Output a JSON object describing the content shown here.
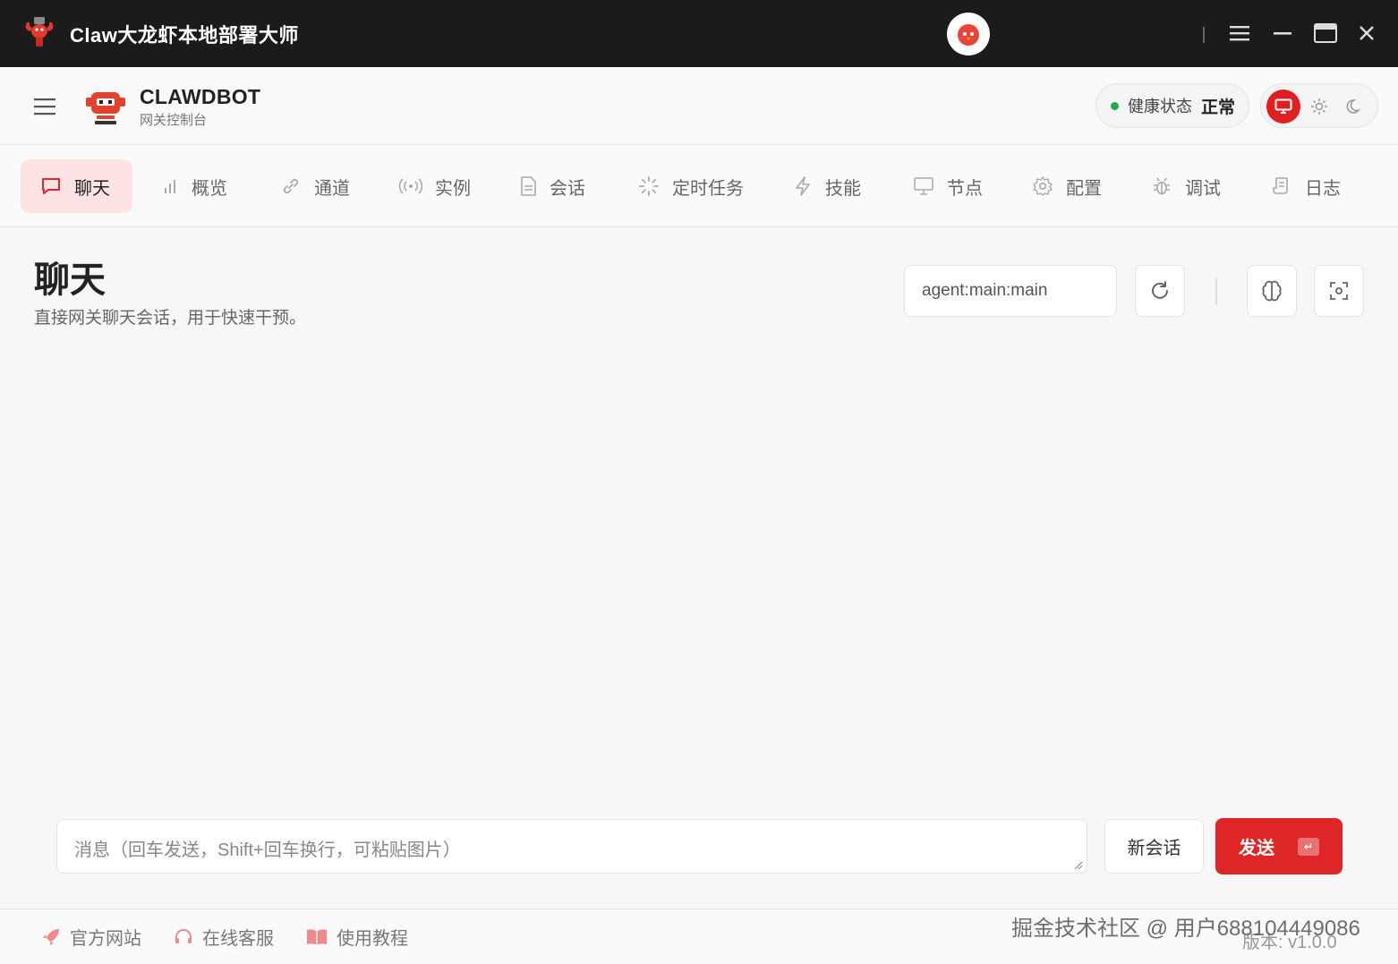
{
  "window": {
    "title": "Claw大龙虾本地部署大师",
    "controls": [
      "menu-icon",
      "minimize-icon",
      "maximize-icon",
      "close-icon"
    ]
  },
  "header": {
    "brand_name": "CLAWDBOT",
    "brand_sub": "网关控制台",
    "health_label": "健康状态",
    "health_value": "正常",
    "health_color": "#22a84a"
  },
  "tabs": [
    {
      "label": "聊天",
      "icon": "chat-bubble-icon",
      "active": true
    },
    {
      "label": "概览",
      "icon": "bar-chart-icon"
    },
    {
      "label": "通道",
      "icon": "link-icon"
    },
    {
      "label": "实例",
      "icon": "broadcast-icon"
    },
    {
      "label": "会话",
      "icon": "document-icon"
    },
    {
      "label": "定时任务",
      "icon": "loader-icon"
    },
    {
      "label": "技能",
      "icon": "lightning-icon"
    },
    {
      "label": "节点",
      "icon": "monitor-icon"
    },
    {
      "label": "配置",
      "icon": "gear-icon"
    },
    {
      "label": "调试",
      "icon": "bug-icon"
    },
    {
      "label": "日志",
      "icon": "scroll-icon"
    }
  ],
  "main": {
    "title": "聊天",
    "subtitle": "直接网关聊天会话，用于快速干预。",
    "session_value": "agent:main:main"
  },
  "composer": {
    "placeholder": "消息（回车发送，Shift+回车换行，可粘贴图片）",
    "new_chat_label": "新会话",
    "send_label": "发送"
  },
  "footer": {
    "links": [
      {
        "label": "官方网站",
        "icon": "rocket-icon"
      },
      {
        "label": "在线客服",
        "icon": "headset-icon"
      },
      {
        "label": "使用教程",
        "icon": "book-icon"
      }
    ],
    "version": "版本: v1.0.0"
  },
  "watermark": "掘金技术社区 @ 用户688104449086",
  "colors": {
    "accent": "#df2626",
    "active_tab_bg": "#fde3e3",
    "titlebar": "#1b1b1b"
  }
}
